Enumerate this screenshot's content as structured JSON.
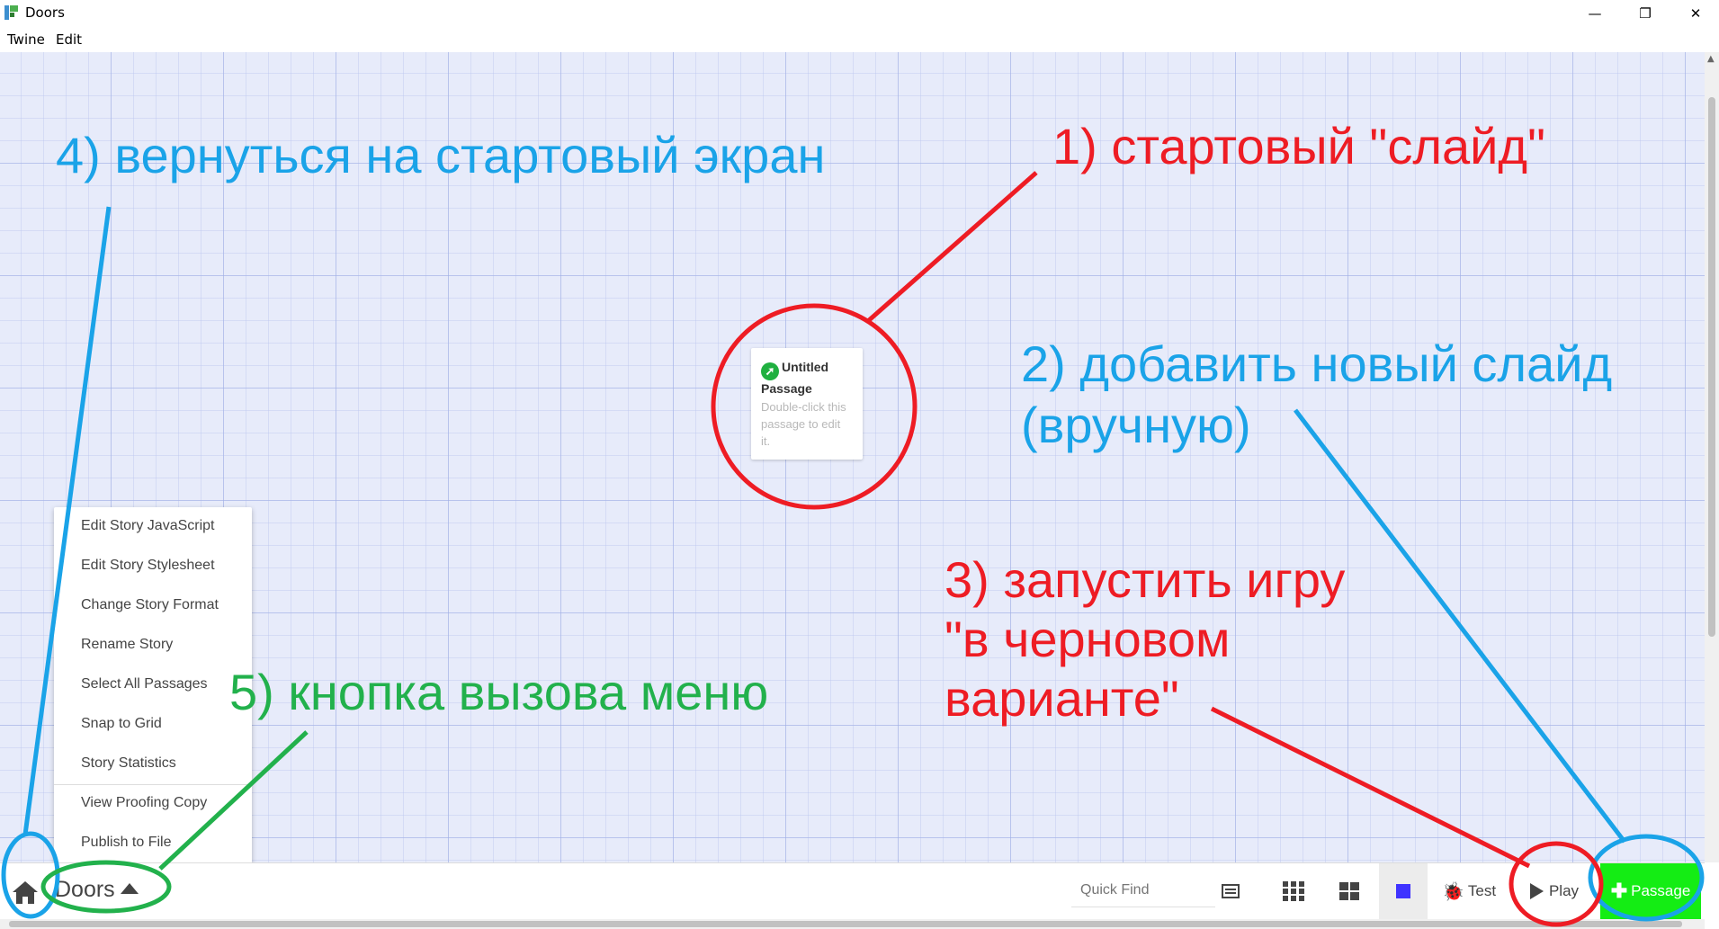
{
  "window": {
    "title": "Doors",
    "controls": {
      "minimize": "—",
      "restore": "❐",
      "close": "✕"
    }
  },
  "menubar": {
    "items": [
      "Twine",
      "Edit"
    ]
  },
  "passage": {
    "title": "Untitled Passage",
    "excerpt": "Double-click this passage to edit it.",
    "start_icon": "rocket-icon"
  },
  "story_menu": {
    "items": [
      "Edit Story JavaScript",
      "Edit Story Stylesheet",
      "Change Story Format",
      "Rename Story",
      "Select All Passages",
      "Snap to Grid",
      "Story Statistics",
      "View Proofing Copy",
      "Publish to File"
    ]
  },
  "toolbar": {
    "story_name": "Doors",
    "quick_find_placeholder": "Quick Find",
    "test_label": "Test",
    "play_label": "Play",
    "add_passage_label": "Passage",
    "highlight_color": "#3f33ff",
    "add_passage_color": "#14ed14"
  },
  "annotations": {
    "a1": "1) стартовый \"слайд\"",
    "a2_line1": "2) добавить новый слайд",
    "a2_line2": "(вручную)",
    "a3_line1": "3) запустить игру",
    "a3_line2": "\"в черновом",
    "a3_line3": "варианте\"",
    "a4": "4) вернуться на стартовый экран",
    "a5": "5) кнопка вызова меню",
    "colors": {
      "red": "#ee1c24",
      "blue": "#1aa3e8",
      "green": "#22b14c"
    }
  }
}
